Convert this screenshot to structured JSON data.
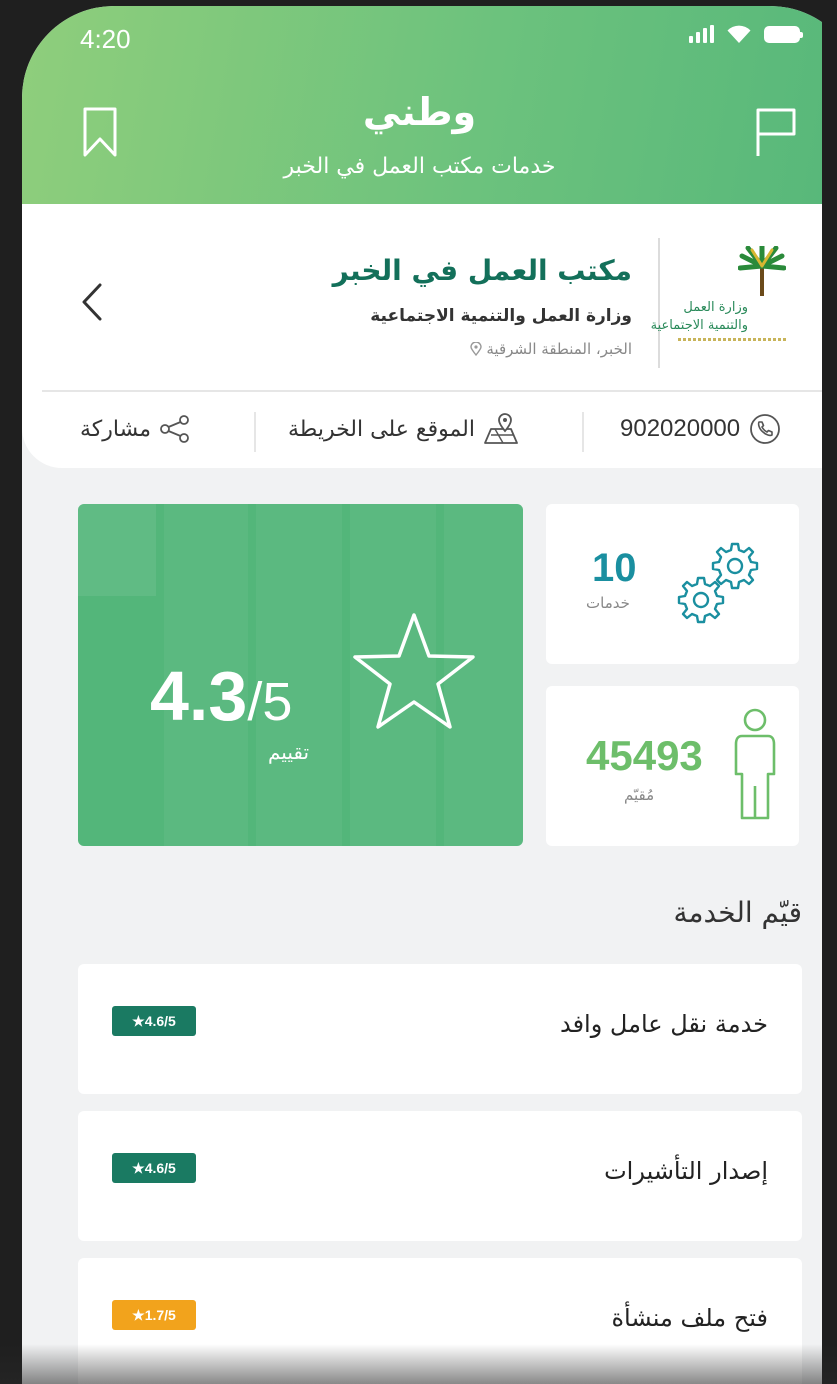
{
  "status_bar": {
    "time": "4:20"
  },
  "header": {
    "title": "وطني",
    "subtitle": "خدمات مكتب العمل في الخبر",
    "bookmark_icon": "bookmark-icon",
    "flag_icon": "flag-icon"
  },
  "office": {
    "name": "مكتب العمل في الخبر",
    "ministry": "وزارة العمل والتنمية الاجتماعية",
    "location": "الخبر، المنطقة الشرقية",
    "logo_line1": "وزارة العمل",
    "logo_line2": "والتنمية الاجتماعية"
  },
  "actions": {
    "phone": "902020000",
    "map": "الموقع على الخريطة",
    "share": "مشاركة"
  },
  "stats": {
    "rating_value": "4.3",
    "rating_max": "/5",
    "rating_label": "تقييم",
    "services_count": "10",
    "services_label": "خدمات",
    "residents_count": "45493",
    "residents_label": "مُقيّم"
  },
  "services_section": {
    "title": "قيّم الخدمة",
    "items": [
      {
        "name": "خدمة نقل عامل وافد",
        "rating": "★4.6/5",
        "color": "#1a7a62"
      },
      {
        "name": "إصدار التأشيرات",
        "rating": "★4.6/5",
        "color": "#1a7a62"
      },
      {
        "name": "فتح ملف منشأة",
        "rating": "★1.7/5",
        "color": "#f2a31c"
      }
    ]
  },
  "colors": {
    "header_green": "#6cc27d",
    "rating_card": "#53b67a",
    "office_name": "#13705a",
    "services_accent": "#1a8fa0",
    "residents_accent": "#6dbe6a"
  }
}
